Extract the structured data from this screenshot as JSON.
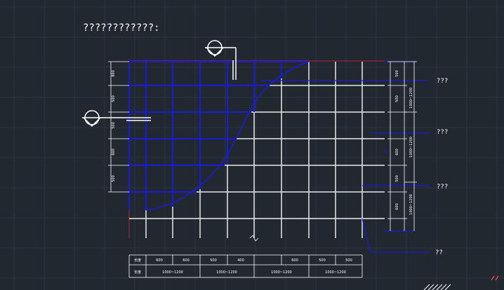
{
  "drawing": {
    "title": "????????????:",
    "callouts": [
      "???",
      "???",
      "???",
      "??"
    ],
    "left_dims": [
      "800",
      "500",
      "500",
      "600",
      "500"
    ],
    "right_dims_a": [
      "500",
      "500",
      "600",
      "500",
      "600"
    ],
    "right_dims_b": [
      "1000~1200",
      "1000~1200",
      "1000~1200"
    ],
    "bottom_row1": [
      "600",
      "600",
      "500",
      "400",
      "600",
      "500",
      "500"
    ],
    "bottom_row1_label": "长度",
    "bottom_row2": [
      "1000~1200",
      "1000~1200",
      "1000~1200",
      "1000~1200"
    ],
    "bottom_row2_label": "长度"
  },
  "colors": {
    "background": "#212830",
    "grid": "#2c3540",
    "frame": "#c02040",
    "blue": "#1a1adc",
    "white": "#ffffff",
    "accent_red": "#ff4a4a"
  }
}
